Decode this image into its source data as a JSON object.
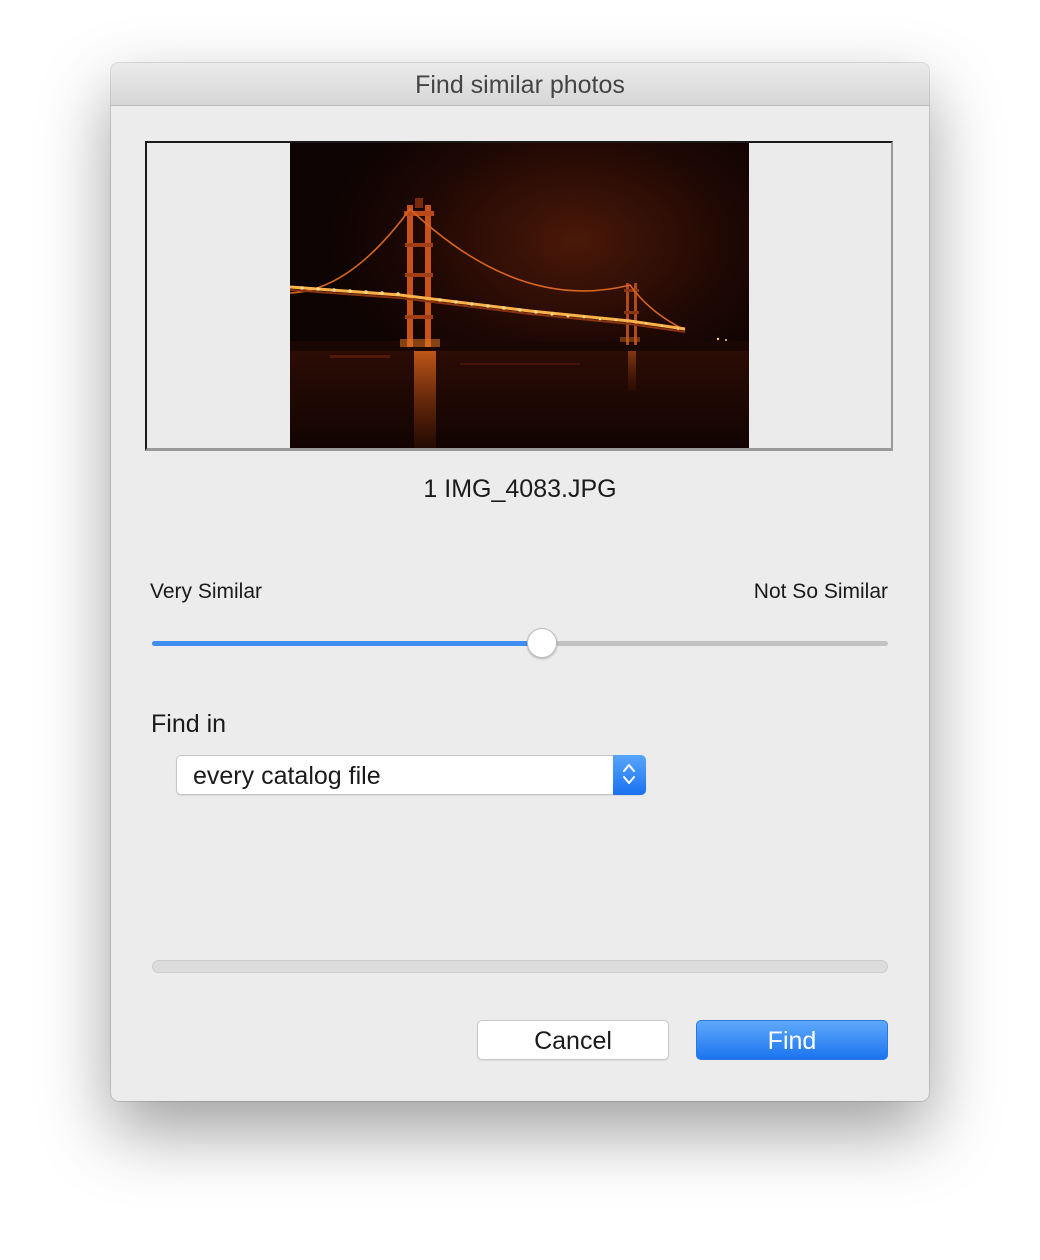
{
  "dialog": {
    "title": "Find similar photos"
  },
  "preview": {
    "file_label": "1 IMG_4083.JPG"
  },
  "similarity": {
    "min_label": "Very Similar",
    "max_label": "Not So Similar",
    "value": 0.53,
    "accent_color": "#3d8ef0"
  },
  "scope": {
    "label": "Find in",
    "selected": "every catalog file",
    "stepper_icon": "chevron-up-down-icon"
  },
  "progress": {
    "value": 0
  },
  "buttons": {
    "cancel_label": "Cancel",
    "find_label": "Find"
  }
}
